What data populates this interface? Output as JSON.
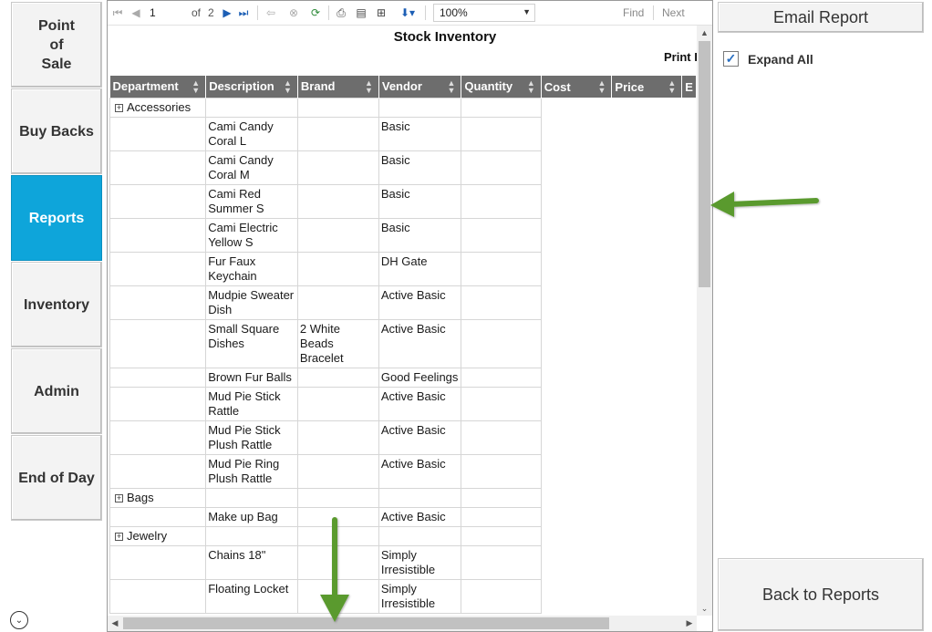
{
  "nav": [
    {
      "label": "Point\nof\nSale"
    },
    {
      "label": "Buy Backs"
    },
    {
      "label": "Reports"
    },
    {
      "label": "Inventory"
    },
    {
      "label": "Admin"
    },
    {
      "label": "End of Day"
    }
  ],
  "toolbar": {
    "page": "1",
    "of_label": "of",
    "total_pages": "2",
    "zoom": "100%",
    "find": "Find",
    "next": "Next"
  },
  "report": {
    "title": "Stock Inventory",
    "print_label": "Print I",
    "columns": [
      "Department",
      "Description",
      "Brand",
      "Vendor",
      "Quantity",
      "Cost",
      "Price",
      "E"
    ],
    "rows": [
      {
        "group": "Accessories"
      },
      {
        "description": "Cami Candy Coral L",
        "brand": "",
        "vendor": "Basic"
      },
      {
        "description": "Cami Candy Coral M",
        "brand": "",
        "vendor": "Basic"
      },
      {
        "description": "Cami Red Summer S",
        "brand": "",
        "vendor": "Basic"
      },
      {
        "description": "Cami Electric Yellow S",
        "brand": "",
        "vendor": "Basic"
      },
      {
        "description": "Fur Faux Keychain",
        "brand": "",
        "vendor": "DH Gate"
      },
      {
        "description": "Mudpie Sweater Dish",
        "brand": "",
        "vendor": "Active Basic"
      },
      {
        "description": "Small Square Dishes",
        "brand": "2 White Beads Bracelet",
        "vendor": "Active Basic"
      },
      {
        "description": "Brown Fur Balls",
        "brand": "",
        "vendor": "Good Feelings"
      },
      {
        "description": "Mud Pie Stick Rattle",
        "brand": "",
        "vendor": "Active Basic"
      },
      {
        "description": "Mud Pie Stick Plush Rattle",
        "brand": "",
        "vendor": "Active Basic"
      },
      {
        "description": "Mud Pie Ring Plush Rattle",
        "brand": "",
        "vendor": "Active Basic"
      },
      {
        "group": "Bags"
      },
      {
        "description": "Make up Bag",
        "brand": "",
        "vendor": "Active Basic"
      },
      {
        "group": "Jewelry"
      },
      {
        "description": "Chains 18\"",
        "brand": "",
        "vendor": "Simply Irresistible"
      },
      {
        "description": "Floating Locket",
        "brand": "",
        "vendor": "Simply Irresistible"
      }
    ]
  },
  "right_panel": {
    "email_report": "Email Report",
    "expand_all": "Expand All",
    "expand_all_checked": true,
    "back_to_reports": "Back to Reports"
  },
  "colors": {
    "active_nav": "#0ea5da",
    "header_bg": "#6d6d6d",
    "annotation_arrow": "#5a9a2f"
  }
}
